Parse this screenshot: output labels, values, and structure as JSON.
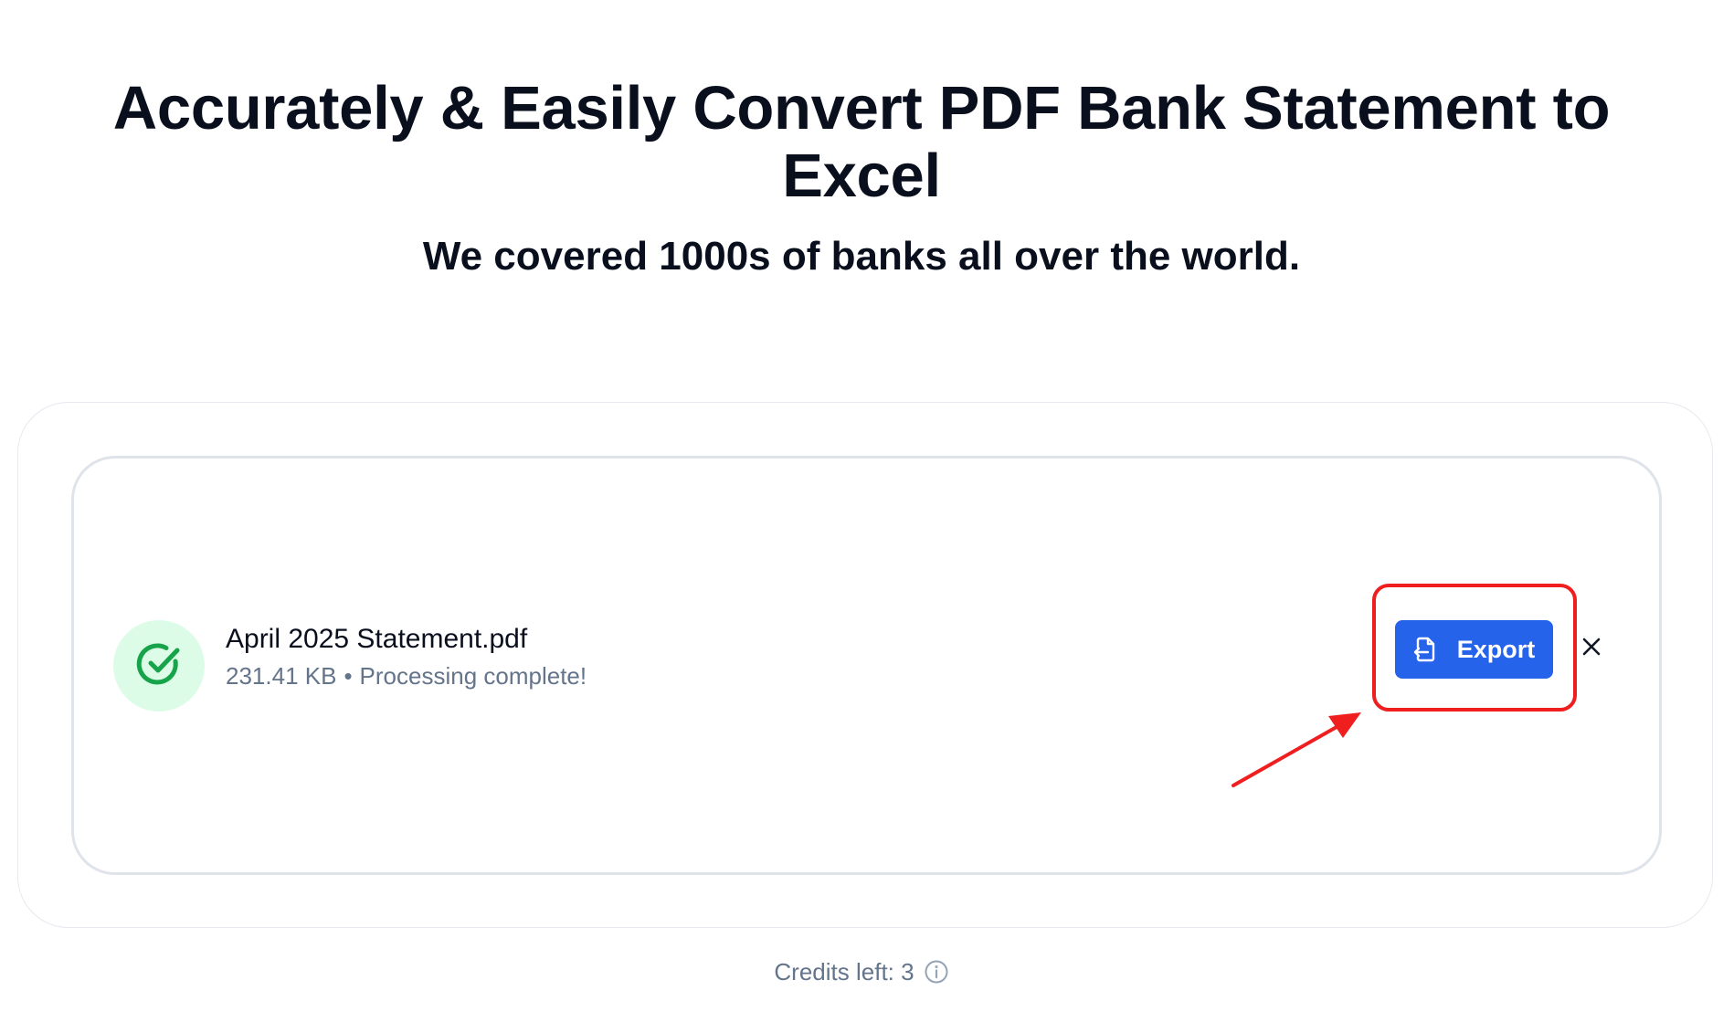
{
  "hero": {
    "title": "Accurately & Easily Convert PDF Bank Statement to Excel",
    "subtitle": "We covered 1000s of banks all over the world."
  },
  "file": {
    "name": "April 2025 Statement.pdf",
    "size": "231.41 KB",
    "separator": "•",
    "status": "Processing complete!",
    "status_icon": "check-circle-icon"
  },
  "actions": {
    "export_label": "Export",
    "export_icon": "file-export-icon",
    "close_icon": "close-icon"
  },
  "footer": {
    "credits_label": "Credits left: 3",
    "info_icon": "info-icon"
  },
  "colors": {
    "primary": "#2563eb",
    "success": "#16a34a",
    "success_bg": "#dcfce7",
    "annotation": "#ef1f1f",
    "muted_text": "#64748b"
  }
}
